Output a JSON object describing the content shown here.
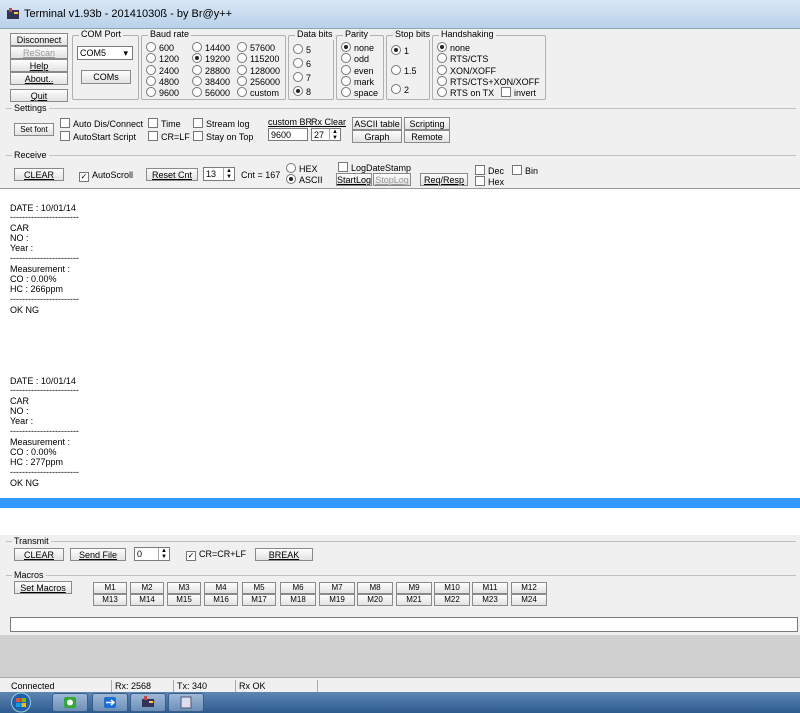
{
  "window": {
    "title": "Terminal v1.93b - 20141030ß - by Br@y++"
  },
  "left_buttons": {
    "disconnect": "Disconnect",
    "rescan": "ReScan",
    "help": "Help",
    "about": "About..",
    "quit": "Quit"
  },
  "com_port": {
    "label": "COM Port",
    "value": "COM5",
    "coms_button": "COMs"
  },
  "baud_rate": {
    "label": "Baud rate",
    "options": [
      "600",
      "1200",
      "2400",
      "4800",
      "9600",
      "14400",
      "19200",
      "28800",
      "38400",
      "56000",
      "57600",
      "115200",
      "128000",
      "256000",
      "custom"
    ],
    "selected": "19200"
  },
  "data_bits": {
    "label": "Data bits",
    "options": [
      "5",
      "6",
      "7",
      "8"
    ],
    "selected": "8"
  },
  "parity": {
    "label": "Parity",
    "options": [
      "none",
      "odd",
      "even",
      "mark",
      "space"
    ],
    "selected": "none"
  },
  "stop_bits": {
    "label": "Stop bits",
    "options": [
      "1",
      "1.5",
      "2"
    ],
    "selected": "1"
  },
  "handshaking": {
    "label": "Handshaking",
    "options": [
      "none",
      "RTS/CTS",
      "XON/XOFF",
      "RTS/CTS+XON/XOFF",
      "RTS on TX"
    ],
    "selected": "none",
    "invert_label": "invert"
  },
  "settings": {
    "label": "Settings",
    "set_font": "Set font",
    "auto_dis_connect": "Auto Dis/Connect",
    "autostart_script": "AutoStart Script",
    "time": "Time",
    "cr_lf": "CR=LF",
    "stream_log": "Stream log",
    "stay_on_top": "Stay on Top",
    "custom_br_label": "custom BR",
    "custom_br_value": "9600",
    "rx_clear_label": "Rx Clear",
    "rx_clear_value": "27",
    "ascii_table": "ASCII table",
    "scripting": "Scripting",
    "graph": "Graph",
    "remote": "Remote"
  },
  "receive": {
    "label": "Receive",
    "clear": "CLEAR",
    "autoscroll": "AutoScroll",
    "reset_cnt": "Reset Cnt",
    "cnt_spin": "13",
    "cnt_text": "Cnt =  167",
    "hex": "HEX",
    "ascii": "ASCII",
    "log_date_stamp": "LogDateStamp",
    "start_log": "StartLog",
    "stop_log": "StopLog",
    "req_resp": "Req/Resp",
    "dec": "Dec",
    "bin": "Bin",
    "hex_check": "Hex"
  },
  "receive_lines": [
    "DATE : 10/01/14",
    "-----------------------",
    "CAR",
    "NO :",
    "Year :",
    "-----------------------",
    "Measurement :",
    "CO : 0.00%",
    "HC : 266ppm",
    "-----------------------",
    "   OK        NG",
    "",
    "",
    "",
    "",
    "",
    "",
    "",
    "DATE : 10/01/14",
    "-----------------------",
    "CAR",
    "NO :",
    "Year :",
    "-----------------------",
    "Measurement :",
    "CO : 0.00%",
    "HC : 277ppm",
    "-----------------------",
    "   OK        NG"
  ],
  "transmit": {
    "label": "Transmit",
    "clear": "CLEAR",
    "send_file": "Send File",
    "spin_value": "0",
    "cr_crlf": "CR=CR+LF",
    "break": "BREAK"
  },
  "macros": {
    "label": "Macros",
    "set_macros": "Set Macros",
    "row1": [
      "M1",
      "M2",
      "M3",
      "M4",
      "M5",
      "M6",
      "M7",
      "M8",
      "M9",
      "M10",
      "M11",
      "M12"
    ],
    "row2": [
      "M13",
      "M14",
      "M15",
      "M16",
      "M17",
      "M18",
      "M19",
      "M20",
      "M21",
      "M22",
      "M23",
      "M24"
    ]
  },
  "status": {
    "state": "Connected",
    "rx": "Rx: 2568",
    "tx": "Tx: 340",
    "rx_ok": "Rx OK"
  },
  "colors": {
    "selection": "#3399ff",
    "taskbar": "#2d5b8e"
  }
}
